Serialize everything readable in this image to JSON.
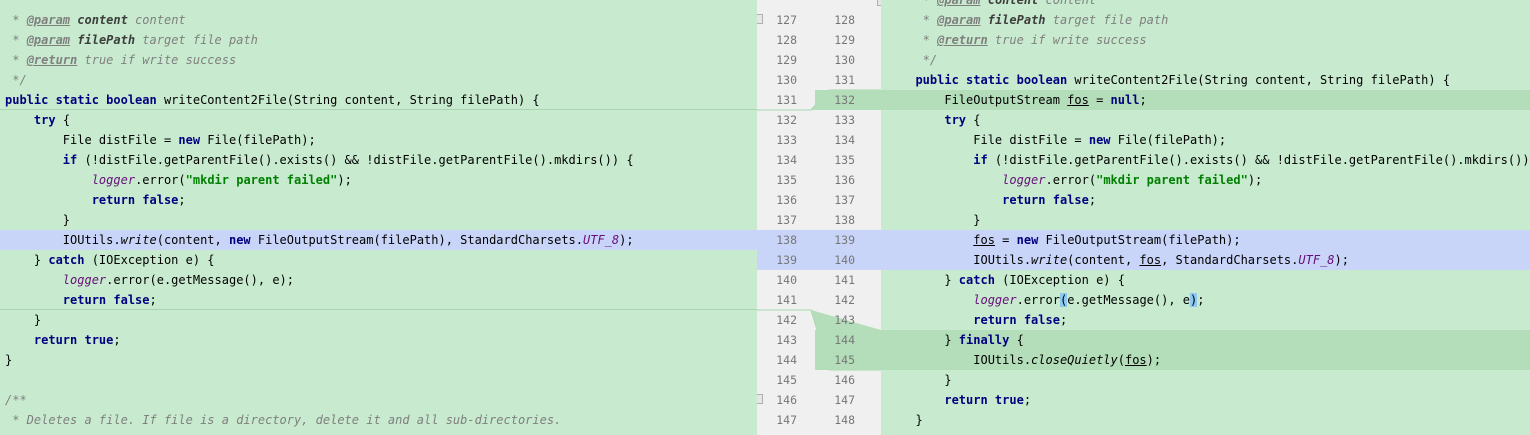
{
  "colors": {
    "added_bg": "#c8ebcf",
    "added_strong_bg": "#b3deb9",
    "modified_bg": "#c9d5f8",
    "gutter_bg": "#f0f0f0"
  },
  "left": {
    "lines": [
      {
        "spans": [
          {
            "t": " * ",
            "c": "cm"
          },
          {
            "t": "@param",
            "c": "tag"
          },
          {
            "t": " ",
            "c": "cm"
          },
          {
            "t": "content",
            "c": "pn"
          },
          {
            "t": " content",
            "c": "cm"
          }
        ]
      },
      {
        "spans": [
          {
            "t": " * ",
            "c": "cm"
          },
          {
            "t": "@param",
            "c": "tag"
          },
          {
            "t": " ",
            "c": "cm"
          },
          {
            "t": "filePath",
            "c": "pn"
          },
          {
            "t": " target file path",
            "c": "cm"
          }
        ]
      },
      {
        "spans": [
          {
            "t": " * ",
            "c": "cm"
          },
          {
            "t": "@return",
            "c": "tag"
          },
          {
            "t": " true if write success",
            "c": "cm"
          }
        ]
      },
      {
        "spans": [
          {
            "t": " */",
            "c": "cm"
          }
        ]
      },
      {
        "spans": [
          {
            "t": "public static boolean",
            "c": "kw"
          },
          {
            "t": " writeContent2File(String content, String filePath) {",
            "c": ""
          }
        ]
      },
      {
        "spans": [
          {
            "t": "    ",
            "c": ""
          },
          {
            "t": "try",
            "c": "kw"
          },
          {
            "t": " {",
            "c": ""
          }
        ]
      },
      {
        "spans": [
          {
            "t": "        File distFile = ",
            "c": ""
          },
          {
            "t": "new",
            "c": "kw"
          },
          {
            "t": " File(filePath);",
            "c": ""
          }
        ]
      },
      {
        "spans": [
          {
            "t": "        ",
            "c": ""
          },
          {
            "t": "if",
            "c": "kw"
          },
          {
            "t": " (!distFile.getParentFile().exists() && !distFile.getParentFile().mkdirs()) {",
            "c": ""
          }
        ]
      },
      {
        "spans": [
          {
            "t": "            ",
            "c": ""
          },
          {
            "t": "logger",
            "c": "fld"
          },
          {
            "t": ".error(",
            "c": ""
          },
          {
            "t": "\"mkdir parent failed\"",
            "c": "str"
          },
          {
            "t": ");",
            "c": ""
          }
        ]
      },
      {
        "spans": [
          {
            "t": "            ",
            "c": ""
          },
          {
            "t": "return false",
            "c": "kw"
          },
          {
            "t": ";",
            "c": ""
          }
        ]
      },
      {
        "spans": [
          {
            "t": "        }",
            "c": ""
          }
        ]
      },
      {
        "spans": [
          {
            "t": "        IOUtils.",
            "c": ""
          },
          {
            "t": "write",
            "c": "it"
          },
          {
            "t": "(content, ",
            "c": ""
          },
          {
            "t": "new",
            "c": "kw"
          },
          {
            "t": " FileOutputStream(filePath), StandardCharsets.",
            "c": ""
          },
          {
            "t": "UTF_8",
            "c": "fld"
          },
          {
            "t": ");",
            "c": ""
          }
        ]
      },
      {
        "spans": [
          {
            "t": "    } ",
            "c": ""
          },
          {
            "t": "catch",
            "c": "kw"
          },
          {
            "t": " (IOException e) {",
            "c": ""
          }
        ]
      },
      {
        "spans": [
          {
            "t": "        ",
            "c": ""
          },
          {
            "t": "logger",
            "c": "fld"
          },
          {
            "t": ".error(e.getMessage(), e);",
            "c": ""
          }
        ]
      },
      {
        "spans": [
          {
            "t": "        ",
            "c": ""
          },
          {
            "t": "return false",
            "c": "kw"
          },
          {
            "t": ";",
            "c": ""
          }
        ]
      },
      {
        "spans": [
          {
            "t": "    }",
            "c": ""
          }
        ]
      },
      {
        "spans": [
          {
            "t": "    ",
            "c": ""
          },
          {
            "t": "return true",
            "c": "kw"
          },
          {
            "t": ";",
            "c": ""
          }
        ]
      },
      {
        "spans": [
          {
            "t": "}",
            "c": ""
          }
        ]
      },
      {
        "spans": []
      },
      {
        "spans": [
          {
            "t": "/**",
            "c": "cm"
          }
        ]
      },
      {
        "spans": [
          {
            "t": " * Deletes a file. If file is a directory, delete it and all sub-directories.",
            "c": "cm"
          }
        ]
      }
    ]
  },
  "right": {
    "lines": [
      {
        "spans": [
          {
            "t": "   * ",
            "c": "cm"
          },
          {
            "t": "@param",
            "c": "tag"
          },
          {
            "t": " ",
            "c": "cm"
          },
          {
            "t": "content",
            "c": "pn"
          },
          {
            "t": " content",
            "c": "cm"
          }
        ]
      },
      {
        "spans": [
          {
            "t": "   * ",
            "c": "cm"
          },
          {
            "t": "@param",
            "c": "tag"
          },
          {
            "t": " ",
            "c": "cm"
          },
          {
            "t": "filePath",
            "c": "pn"
          },
          {
            "t": " target file path",
            "c": "cm"
          }
        ]
      },
      {
        "spans": [
          {
            "t": "   * ",
            "c": "cm"
          },
          {
            "t": "@return",
            "c": "tag"
          },
          {
            "t": " true if write success",
            "c": "cm"
          }
        ]
      },
      {
        "spans": [
          {
            "t": "   */",
            "c": "cm"
          }
        ]
      },
      {
        "spans": [
          {
            "t": "  ",
            "c": ""
          },
          {
            "t": "public static boolean",
            "c": "kw"
          },
          {
            "t": " writeContent2File(String content, String filePath) {",
            "c": ""
          }
        ]
      },
      {
        "spans": [
          {
            "t": "      FileOutputStream ",
            "c": ""
          },
          {
            "t": "fos",
            "c": "ul"
          },
          {
            "t": " = ",
            "c": ""
          },
          {
            "t": "null",
            "c": "kw"
          },
          {
            "t": ";",
            "c": ""
          }
        ]
      },
      {
        "spans": [
          {
            "t": "      ",
            "c": ""
          },
          {
            "t": "try",
            "c": "kw"
          },
          {
            "t": " {",
            "c": ""
          }
        ]
      },
      {
        "spans": [
          {
            "t": "          File distFile = ",
            "c": ""
          },
          {
            "t": "new",
            "c": "kw"
          },
          {
            "t": " File(filePath);",
            "c": ""
          }
        ]
      },
      {
        "spans": [
          {
            "t": "          ",
            "c": ""
          },
          {
            "t": "if",
            "c": "kw"
          },
          {
            "t": " (!distFile.getParentFile().exists() && !distFile.getParentFile().mkdirs()) {",
            "c": ""
          }
        ]
      },
      {
        "spans": [
          {
            "t": "              ",
            "c": ""
          },
          {
            "t": "logger",
            "c": "fld"
          },
          {
            "t": ".error(",
            "c": ""
          },
          {
            "t": "\"mkdir parent failed\"",
            "c": "str"
          },
          {
            "t": ");",
            "c": ""
          }
        ]
      },
      {
        "spans": [
          {
            "t": "              ",
            "c": ""
          },
          {
            "t": "return false",
            "c": "kw"
          },
          {
            "t": ";",
            "c": ""
          }
        ]
      },
      {
        "spans": [
          {
            "t": "          }",
            "c": ""
          }
        ]
      },
      {
        "spans": [
          {
            "t": "          ",
            "c": ""
          },
          {
            "t": "fos",
            "c": "ul"
          },
          {
            "t": " = ",
            "c": ""
          },
          {
            "t": "new",
            "c": "kw"
          },
          {
            "t": " FileOutputStream(filePath);",
            "c": ""
          }
        ]
      },
      {
        "spans": [
          {
            "t": "          IOUtils.",
            "c": ""
          },
          {
            "t": "write",
            "c": "it"
          },
          {
            "t": "(content, ",
            "c": ""
          },
          {
            "t": "fos",
            "c": "ul"
          },
          {
            "t": ", StandardCharsets.",
            "c": ""
          },
          {
            "t": "UTF_8",
            "c": "fld"
          },
          {
            "t": ");",
            "c": ""
          }
        ]
      },
      {
        "spans": [
          {
            "t": "      } ",
            "c": ""
          },
          {
            "t": "catch",
            "c": "kw"
          },
          {
            "t": " (IOException e) {",
            "c": ""
          }
        ]
      },
      {
        "spans": [
          {
            "t": "          ",
            "c": ""
          },
          {
            "t": "logger",
            "c": "fld"
          },
          {
            "t": ".error",
            "c": ""
          },
          {
            "t": "(",
            "c": "hl"
          },
          {
            "t": "e.getMessage(), e",
            "c": ""
          },
          {
            "t": ")",
            "c": "hl"
          },
          {
            "t": ";",
            "c": ""
          }
        ]
      },
      {
        "spans": [
          {
            "t": "          ",
            "c": ""
          },
          {
            "t": "return false",
            "c": "kw"
          },
          {
            "t": ";",
            "c": ""
          }
        ]
      },
      {
        "spans": [
          {
            "t": "      } ",
            "c": ""
          },
          {
            "t": "finally",
            "c": "kw"
          },
          {
            "t": " {",
            "c": ""
          }
        ]
      },
      {
        "spans": [
          {
            "t": "          IOUtils.",
            "c": ""
          },
          {
            "t": "closeQuietly",
            "c": "it"
          },
          {
            "t": "(",
            "c": ""
          },
          {
            "t": "fos",
            "c": "ul"
          },
          {
            "t": ");",
            "c": ""
          }
        ]
      },
      {
        "spans": [
          {
            "t": "      }",
            "c": ""
          }
        ]
      },
      {
        "spans": [
          {
            "t": "      ",
            "c": ""
          },
          {
            "t": "return true",
            "c": "kw"
          },
          {
            "t": ";",
            "c": ""
          }
        ]
      },
      {
        "spans": [
          {
            "t": "  }",
            "c": ""
          }
        ]
      }
    ]
  },
  "gutter": {
    "rows": [
      {
        "l": "",
        "r": ""
      },
      {
        "l": "127",
        "r": "128"
      },
      {
        "l": "128",
        "r": "129"
      },
      {
        "l": "129",
        "r": "130"
      },
      {
        "l": "130",
        "r": "131"
      },
      {
        "l": "131",
        "r": "132"
      },
      {
        "l": "132",
        "r": "133"
      },
      {
        "l": "133",
        "r": "134"
      },
      {
        "l": "134",
        "r": "135"
      },
      {
        "l": "135",
        "r": "136"
      },
      {
        "l": "136",
        "r": "137"
      },
      {
        "l": "137",
        "r": "138"
      },
      {
        "l": "138",
        "r": "139"
      },
      {
        "l": "139",
        "r": "140"
      },
      {
        "l": "140",
        "r": "141"
      },
      {
        "l": "141",
        "r": "142"
      },
      {
        "l": "142",
        "r": "143"
      },
      {
        "l": "143",
        "r": "144"
      },
      {
        "l": "144",
        "r": "145"
      },
      {
        "l": "145",
        "r": "146"
      },
      {
        "l": "146",
        "r": "147"
      },
      {
        "l": "147",
        "r": "148"
      }
    ]
  }
}
